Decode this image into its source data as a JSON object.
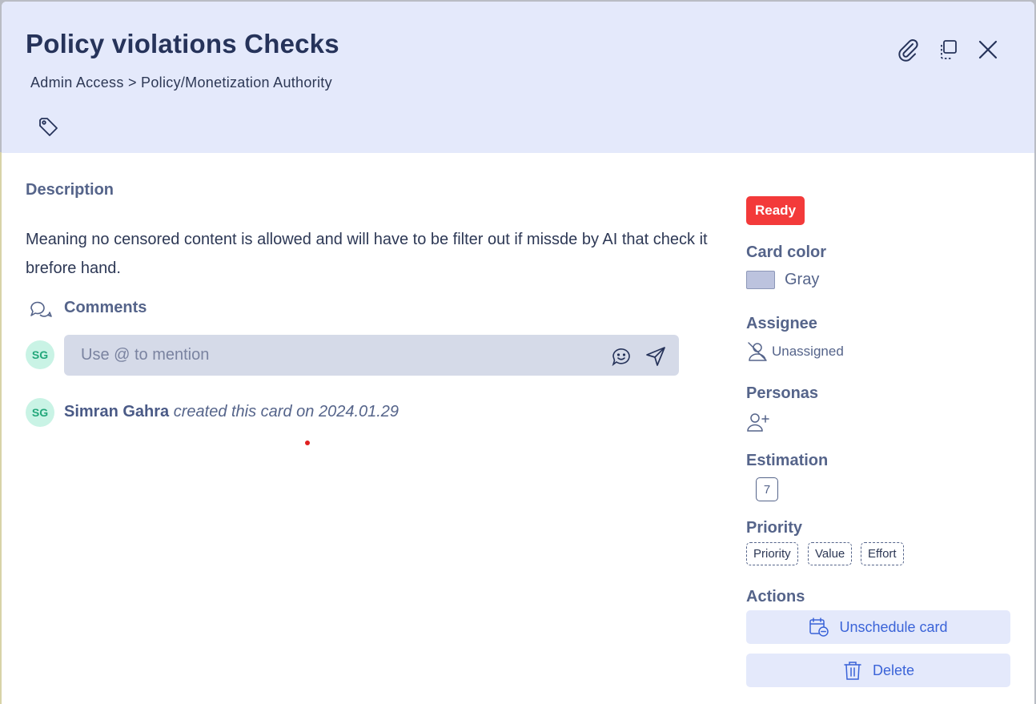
{
  "card": {
    "title": "Policy violations Checks",
    "breadcrumb": "Admin Access > Policy/Monetization Authority"
  },
  "header_icons": [
    "tag-icon",
    "paperclip-icon",
    "duplicate-icon",
    "close-icon"
  ],
  "description": {
    "label": "Description",
    "text": "Meaning no censored content is allowed and will have to be filter out if missde by AI that check it brefore hand."
  },
  "comments": {
    "label": "Comments",
    "avatar_initials": "SG",
    "placeholder": "Use @ to mention",
    "value": ""
  },
  "activity": {
    "avatar_initials": "SG",
    "author": "Simran Gahra",
    "text": "created this card on 2024.01.29"
  },
  "sidebar": {
    "status": "Ready",
    "card_color": {
      "label": "Card color",
      "value": "Gray",
      "swatch": "#bcc3de"
    },
    "assignee": {
      "label": "Assignee",
      "value": "Unassigned"
    },
    "personas": {
      "label": "Personas"
    },
    "estimation": {
      "label": "Estimation",
      "value": "7"
    },
    "priority": {
      "label": "Priority",
      "chips": [
        "Priority",
        "Value",
        "Effort"
      ]
    },
    "actions": {
      "label": "Actions",
      "unschedule": "Unschedule card",
      "delete": "Delete"
    }
  },
  "colors": {
    "header_bg": "#e4e9fb",
    "title": "#26335a",
    "label": "#55648a",
    "status_badge": "#f33a3a",
    "accent": "#3a63d8",
    "avatar_bg": "#c9f3e5",
    "avatar_text": "#22a77a"
  }
}
